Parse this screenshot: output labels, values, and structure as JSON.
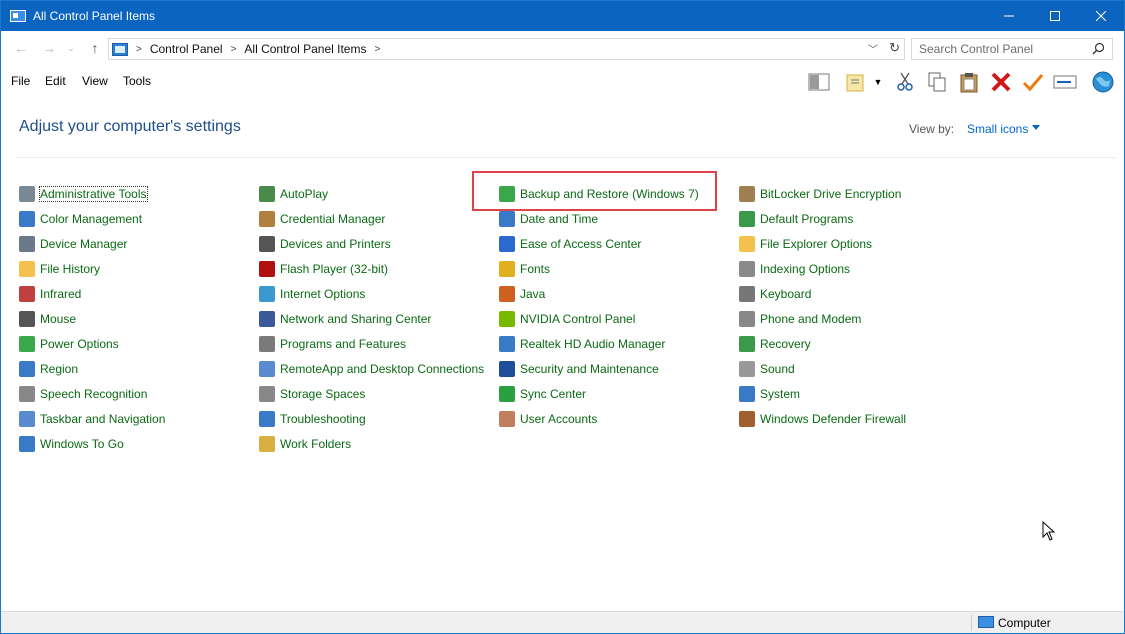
{
  "window": {
    "title": "All Control Panel Items"
  },
  "address": {
    "breadcrumbs": [
      "Control Panel",
      "All Control Panel Items"
    ],
    "search_placeholder": "Search Control Panel"
  },
  "menu": [
    "File",
    "Edit",
    "View",
    "Tools"
  ],
  "toolbar_icons": [
    "pane-toggle-icon",
    "new-folder-icon",
    "cut-icon",
    "copy-icon",
    "paste-icon",
    "delete-icon",
    "checkmark-icon",
    "rename-icon",
    "globe-icon"
  ],
  "content": {
    "heading": "Adjust your computer's settings",
    "view_by_label": "View by:",
    "view_by_value": "Small icons"
  },
  "columns": [
    [
      "Administrative Tools",
      "Color Management",
      "Device Manager",
      "File History",
      "Infrared",
      "Mouse",
      "Power Options",
      "Region",
      "Speech Recognition",
      "Taskbar and Navigation",
      "Windows To Go"
    ],
    [
      "AutoPlay",
      "Credential Manager",
      "Devices and Printers",
      "Flash Player (32-bit)",
      "Internet Options",
      "Network and Sharing Center",
      "Programs and Features",
      "RemoteApp and Desktop Connections",
      "Storage Spaces",
      "Troubleshooting",
      "Work Folders"
    ],
    [
      "Backup and Restore (Windows 7)",
      "Date and Time",
      "Ease of Access Center",
      "Fonts",
      "Java",
      "NVIDIA Control Panel",
      "Realtek HD Audio Manager",
      "Security and Maintenance",
      "Sync Center",
      "User Accounts"
    ],
    [
      "BitLocker Drive Encryption",
      "Default Programs",
      "File Explorer Options",
      "Indexing Options",
      "Keyboard",
      "Phone and Modem",
      "Recovery",
      "Sound",
      "System",
      "Windows Defender Firewall"
    ]
  ],
  "status": {
    "text": "Computer"
  },
  "colors": {
    "titlebar": "#0a64c0",
    "link": "#0b6a14",
    "heading": "#1e4e8c",
    "highlight": "#e0424a"
  }
}
